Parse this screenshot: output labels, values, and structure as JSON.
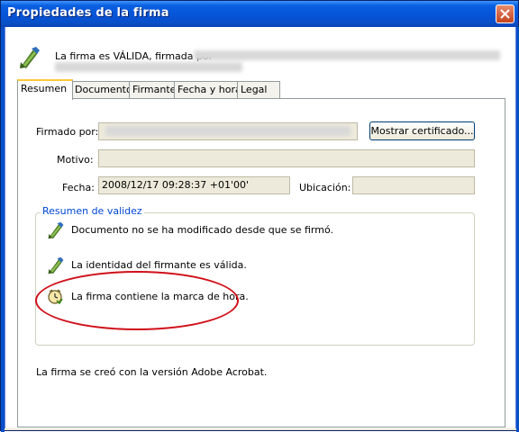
{
  "window": {
    "title": "Propiedades de la firma"
  },
  "header": {
    "status_text": "La firma es VÁLIDA, firmada por"
  },
  "tabs": [
    {
      "label": "Resumen",
      "active": true
    },
    {
      "label": "Documento",
      "active": false
    },
    {
      "label": "Firmante",
      "active": false
    },
    {
      "label": "Fecha y hora",
      "active": false
    },
    {
      "label": "Legal",
      "active": false
    }
  ],
  "summary": {
    "signed_by_label": "Firmado por:",
    "show_cert_label": "Mostrar certificado...",
    "reason_label": "Motivo:",
    "reason_value": "",
    "date_label": "Fecha:",
    "date_value": "2008/12/17 09:28:37 +01'00'",
    "location_label": "Ubicación:",
    "location_value": ""
  },
  "validity": {
    "title": "Resumen de validez",
    "items": [
      {
        "text": "Documento no se ha modificado desde que se firmó.",
        "icon": "pen-check-icon"
      },
      {
        "text": "La identidad del firmante es válida.",
        "icon": "pen-check-icon"
      },
      {
        "text": "La firma contiene la marca de hora.",
        "icon": "clock-icon"
      }
    ]
  },
  "footer": {
    "text": "La firma se creó con la versión Adobe Acrobat."
  },
  "colors": {
    "titlebar": "#0654d8",
    "highlight_ellipse": "#d0101a",
    "group_title": "#0046d5"
  }
}
